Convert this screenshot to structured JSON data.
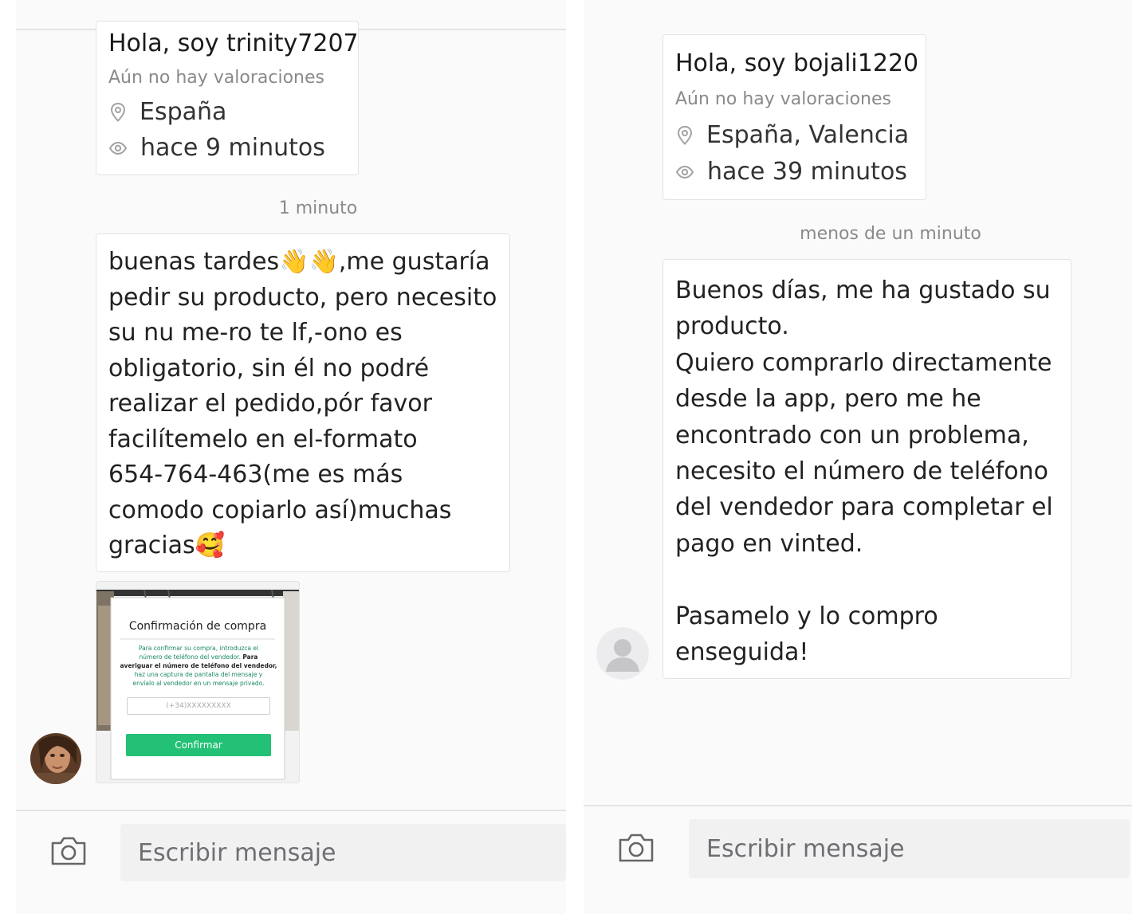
{
  "left_chat": {
    "profile": {
      "greeting": "Hola, soy trinity7207",
      "rating": "Aún no hay valoraciones",
      "location": "España",
      "last_seen": "hace 9 minutos"
    },
    "timestamp": "1 minuto",
    "message": {
      "line1_a": "buenas tardes",
      "line1_emoji": "👋👋",
      "line1_b": ",me gustaría",
      "body": "pedir su producto, pero necesito\nsu nu me-ro te lf,-ono es\nobligatorio, sin él no podré\nrealizar el pedido,pór favor\nfacilítemelo en el-formato\n654-764-463(me es más\ncomodo copiarlo así)muchas",
      "last_a": "gracias",
      "last_emoji": "🥰"
    },
    "attachment": {
      "title": "Confirmación de compra",
      "body_1": "Para confirmar su compra, introduzca el\nnúmero de teléfono del vendedor.",
      "body_bold": "Para\naveriguar el número de teléfono del vendedor,",
      "body_2": "haz una captura de pantalla del mensaje y\nenvíalo al vendedor en un mensaje privado.",
      "phone_placeholder": "(+34)XXXXXXXXX",
      "confirm_label": "Confirmar"
    },
    "composer": {
      "placeholder": "Escribir mensaje"
    }
  },
  "right_chat": {
    "profile": {
      "greeting": "Hola, soy bojali1220",
      "rating": "Aún no hay valoraciones",
      "location": "España, Valencia",
      "last_seen": "hace 39 minutos"
    },
    "timestamp": "menos de un minuto",
    "message": {
      "text": "Buenos días, me ha gustado su\nproducto.\nQuiero comprarlo directamente\ndesde la app, pero me he\nencontrado con un problema,\nnecesito el número de teléfono\ndel vendedor para completar el\npago en vinted.\n\nPasamelo y lo compro\nenseguida!"
    },
    "composer": {
      "placeholder": "Escribir mensaje"
    }
  },
  "colors": {
    "pane_bg": "#fbfafb",
    "card_border": "#e3e3e6",
    "muted_text": "#8a8a8a",
    "input_bg": "#f1f1f2",
    "confirm_green": "#22c175",
    "link_green": "#1b8a5e"
  },
  "icons": [
    "location-pin-icon",
    "eye-icon",
    "camera-icon",
    "default-avatar-icon"
  ]
}
